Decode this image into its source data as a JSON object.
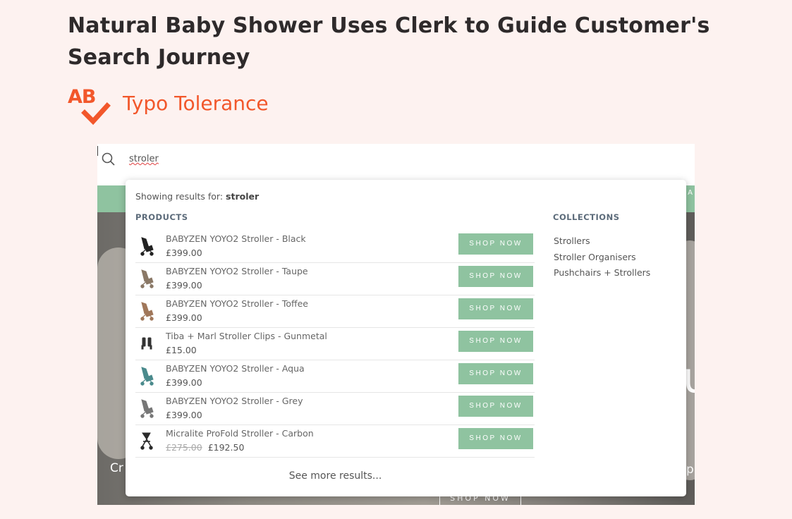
{
  "page": {
    "heading": "Natural Baby Shower Uses Clerk to Guide Customer's Search Journey",
    "feature_icon_text": "AB",
    "feature_title": "Typo Tolerance"
  },
  "search": {
    "query": "stroler"
  },
  "hero": {
    "band_text": "A",
    "big_text": "u",
    "left_text": "Cr",
    "right_text": "p",
    "button_label": "SHOP NOW"
  },
  "dropdown": {
    "showing_prefix": "Showing results for:",
    "showing_term": "stroler",
    "products_label": "PRODUCTS",
    "collections_label": "COLLECTIONS",
    "products": [
      {
        "name": "BABYZEN YOYO2 Stroller - Black",
        "price": "£399.00",
        "old_price": "",
        "button": "SHOP NOW",
        "color": "#222222"
      },
      {
        "name": "BABYZEN YOYO2 Stroller - Taupe",
        "price": "£399.00",
        "old_price": "",
        "button": "SHOP NOW",
        "color": "#8a7866"
      },
      {
        "name": "BABYZEN YOYO2 Stroller - Toffee",
        "price": "£399.00",
        "old_price": "",
        "button": "SHOP NOW",
        "color": "#a0775a"
      },
      {
        "name": "Tiba + Marl Stroller Clips - Gunmetal",
        "price": "£15.00",
        "old_price": "",
        "button": "SHOP NOW",
        "color": "#333333"
      },
      {
        "name": "BABYZEN YOYO2 Stroller - Aqua",
        "price": "£399.00",
        "old_price": "",
        "button": "SHOP NOW",
        "color": "#4a8a8c"
      },
      {
        "name": "BABYZEN YOYO2 Stroller - Grey",
        "price": "£399.00",
        "old_price": "",
        "button": "SHOP NOW",
        "color": "#777777"
      },
      {
        "name": "Micralite ProFold Stroller - Carbon",
        "price": "£192.50",
        "old_price": "£275.00",
        "button": "SHOP NOW",
        "color": "#2a2a2a"
      }
    ],
    "collections": [
      "Strollers",
      "Stroller Organisers",
      "Pushchairs + Strollers"
    ],
    "see_more": "See more results..."
  },
  "colors": {
    "accent": "#f2572b",
    "button_green": "#8fc3a0",
    "background": "#fdf2f0"
  }
}
